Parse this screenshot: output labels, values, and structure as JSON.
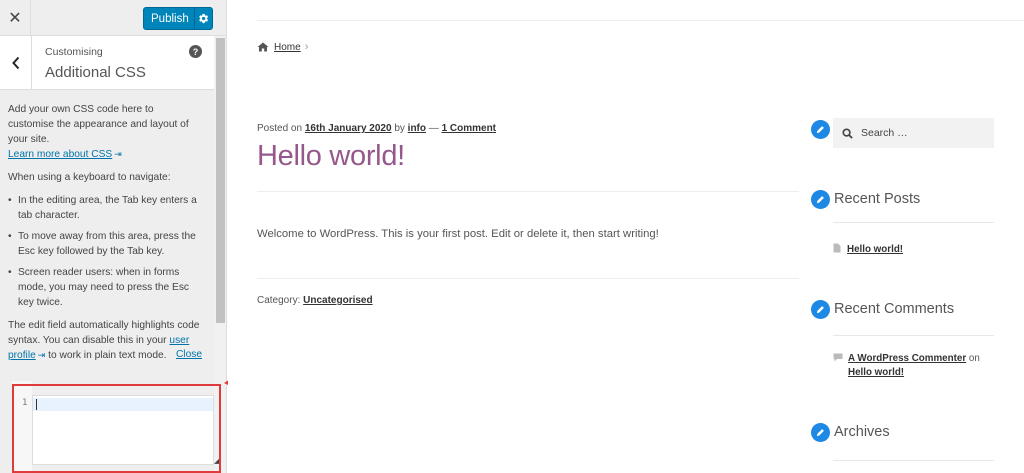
{
  "customizer": {
    "close_label": "✕",
    "publish_label": "Publish",
    "breadcrumb": "Customising",
    "title": "Additional CSS",
    "help_label": "?",
    "desc_intro": "Add your own CSS code here to customise the appearance and layout of your site.",
    "learn_more": "Learn more about CSS",
    "keyboard_intro": "When using a keyboard to navigate:",
    "bullets": [
      "In the editing area, the Tab key enters a tab character.",
      "To move away from this area, press the Esc key followed by the Tab key.",
      "Screen reader users: when in forms mode, you may need to press the Esc key twice."
    ],
    "highlight_pre": "The edit field automatically highlights code syntax. You can disable this in your",
    "user_profile": "user profile",
    "highlight_post": "to work in plain text mode.",
    "close_link": "Close",
    "line_number": "1",
    "code_value": ""
  },
  "site": {
    "breadcrumb_home": "Home",
    "meta_posted_on": "Posted on",
    "meta_date": "16th January 2020",
    "meta_by": "by",
    "meta_author": "info",
    "meta_dash": "—",
    "meta_comments": "1 Comment",
    "post_title": "Hello world!",
    "post_body": "Welcome to WordPress. This is your first post. Edit or delete it, then start writing!",
    "category_label": "Category:",
    "category_value": "Uncategorised",
    "search_placeholder": "Search …",
    "recent_posts_title": "Recent Posts",
    "recent_posts": [
      "Hello world!"
    ],
    "recent_comments_title": "Recent Comments",
    "comment_author": "A WordPress Commenter",
    "comment_on": "on",
    "comment_post": "Hello world!",
    "archives_title": "Archives"
  },
  "colors": {
    "publish_blue": "#0085ba",
    "title_purple": "#96588a",
    "widget_icon_blue": "#1e88e5",
    "annotation_red": "#e03b3b"
  }
}
